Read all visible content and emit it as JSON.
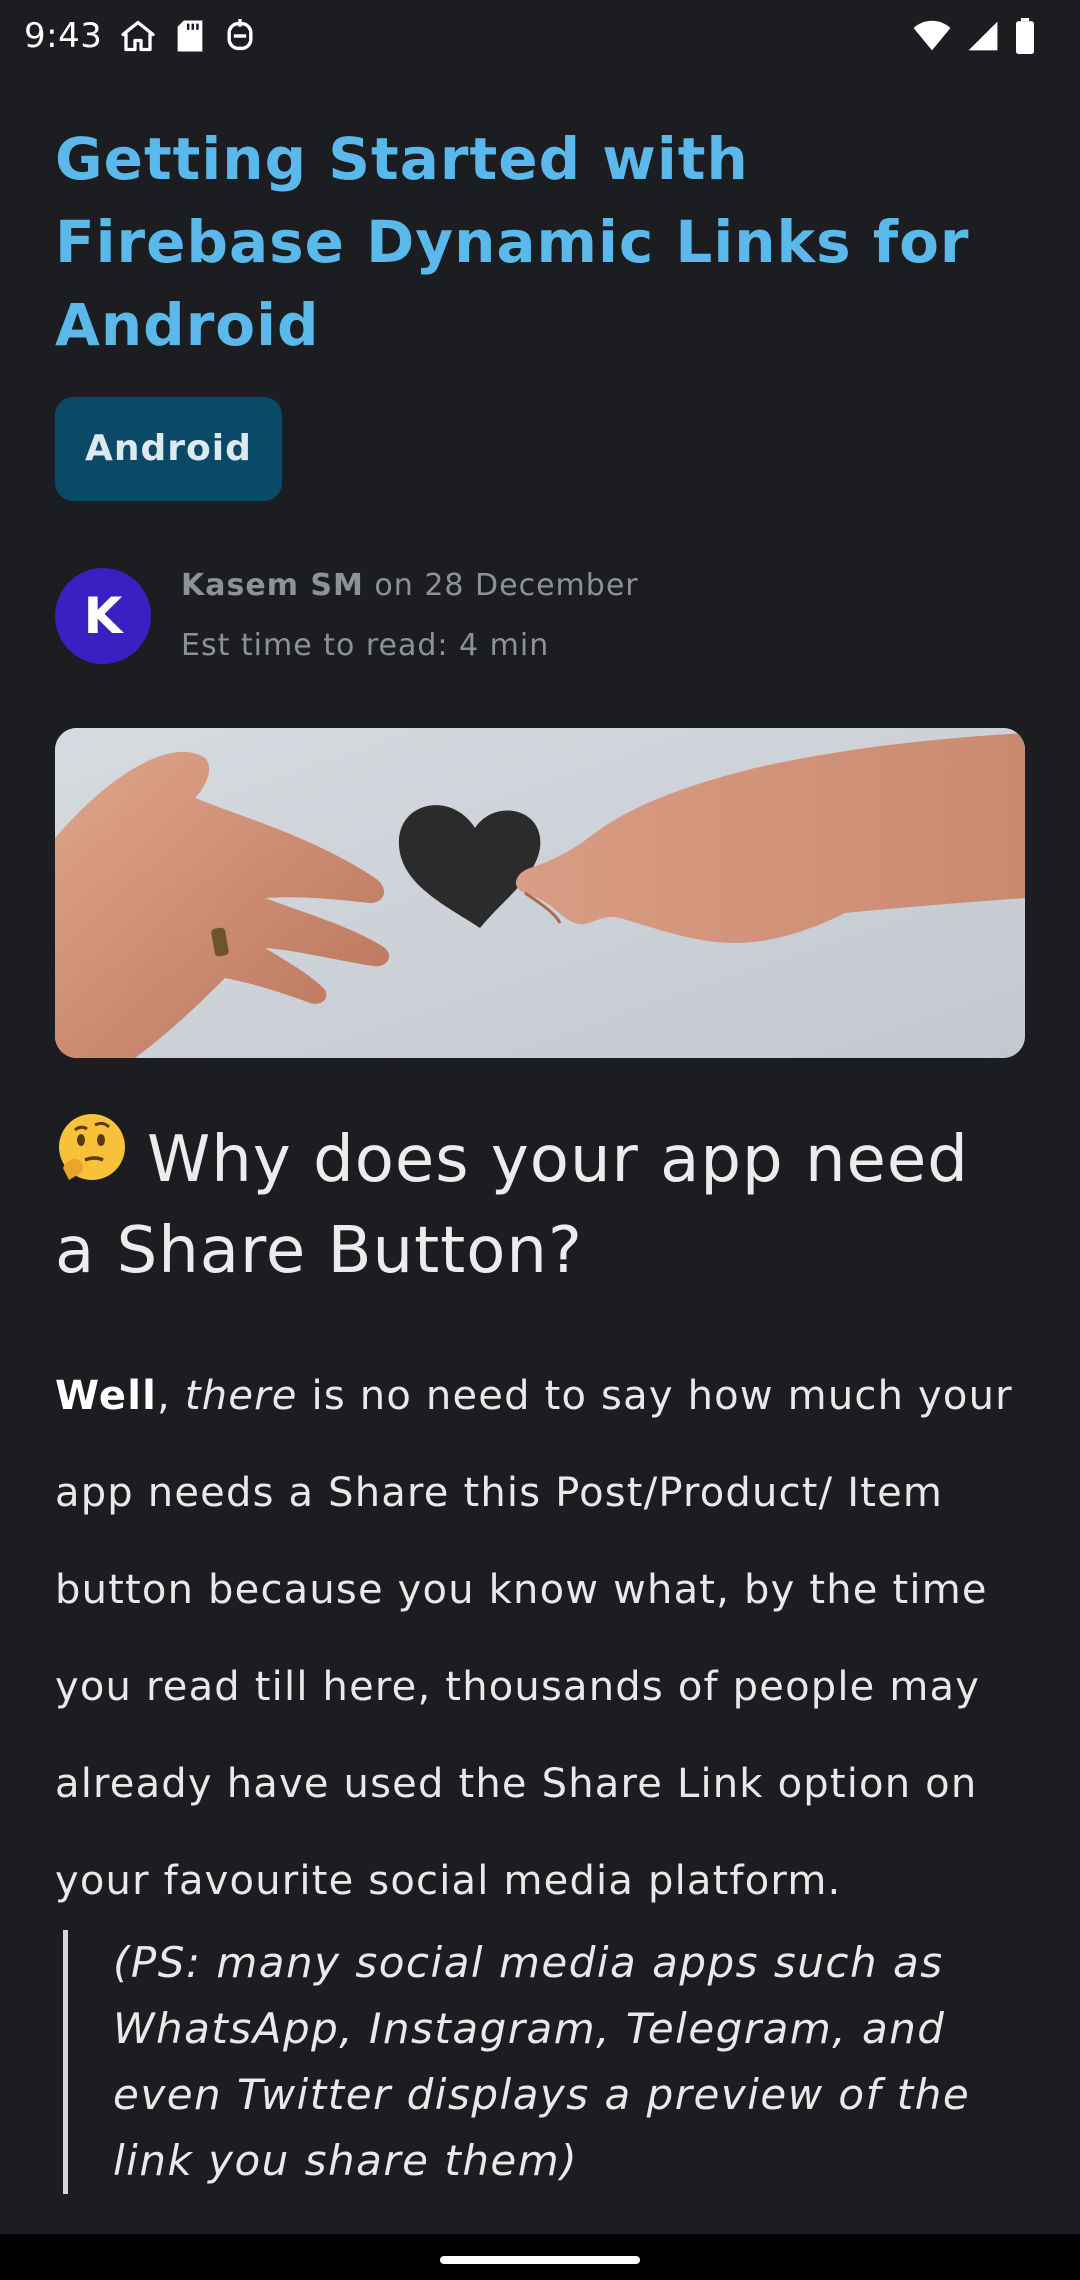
{
  "status_bar": {
    "time": "9:43",
    "left_icons": [
      "home-icon",
      "sd-card-icon",
      "notification-icon"
    ],
    "right_icons": [
      "wifi-icon",
      "signal-icon",
      "battery-icon"
    ]
  },
  "article": {
    "title": "Getting Started with Firebase Dynamic Links for Android",
    "tag": "Android",
    "author": {
      "avatar_letter": "K",
      "name": "Kasem SM",
      "on": "on",
      "date": "28 December",
      "read_time": "Est time to read: 4 min"
    },
    "hero_image_alt": "hands passing a paper heart",
    "section_heading": "Why does your app need a Share Button?",
    "paragraph": {
      "bold": "Well",
      "comma": ",",
      "italic": "there",
      "rest": " is no need to say how much your app needs a Share this Post/Product/ Item button because you know what, by the time you read till here, thousands of people may already have used the Share Link option on your favourite social media platform."
    },
    "quote": "(PS: many social media apps such as WhatsApp, Instagram, Telegram, and even Twitter displays a preview of the link you share them)"
  },
  "colors": {
    "background": "#1b1d21",
    "title": "#5ab9ea",
    "tag_bg": "#0b4a66",
    "avatar_bg": "#3a1fc2"
  }
}
